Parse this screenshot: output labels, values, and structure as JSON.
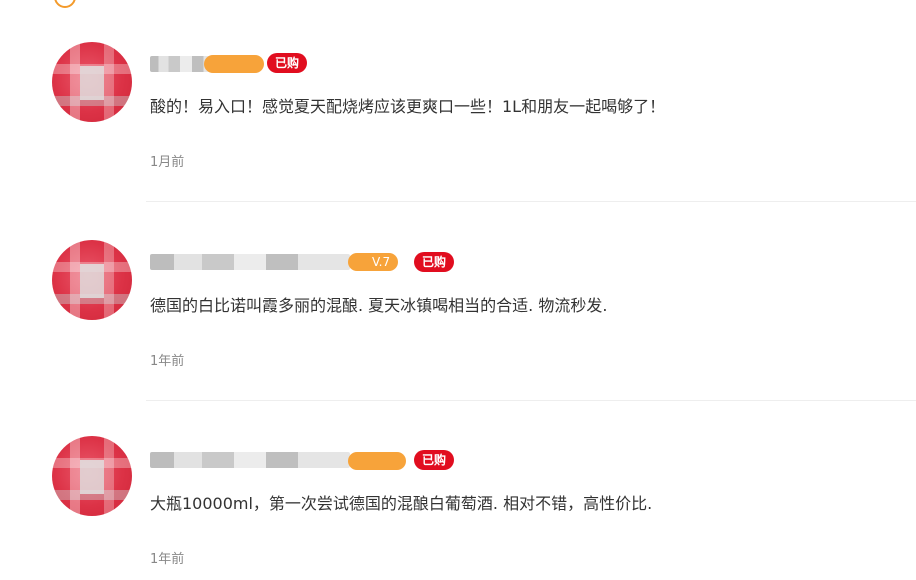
{
  "reviews": [
    {
      "level": "",
      "bought": "已购",
      "content": "酸的！易入口！感觉夏天配烧烤应该更爽口一些！1L和朋友一起喝够了！",
      "time": "1月前"
    },
    {
      "level": "V.7",
      "bought": "已购",
      "content": "德国的白比诺叫霞多丽的混酿. 夏天冰镇喝相当的合适. 物流秒发.",
      "time": "1年前"
    },
    {
      "level": "",
      "bought": "已购",
      "content": "大瓶10000ml，第一次尝试德国的混酿白葡萄酒. 相对不错，高性价比.",
      "time": "1年前"
    }
  ]
}
